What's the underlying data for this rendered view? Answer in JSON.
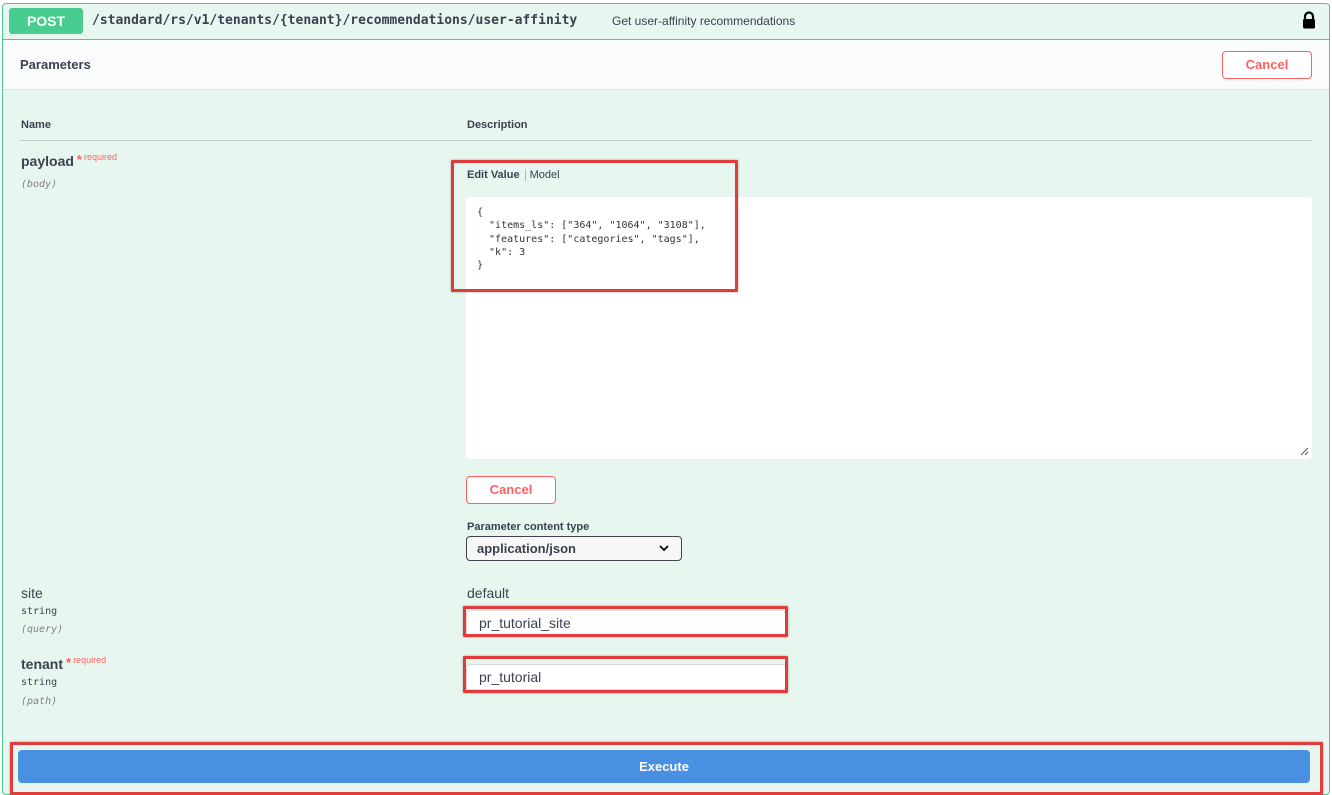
{
  "operation": {
    "method": "POST",
    "path": "/standard/rs/v1/tenants/{tenant}/recommendations/user-affinity",
    "summary": "Get user-affinity recommendations",
    "lock_icon": "lock-icon"
  },
  "parameters_section": {
    "title": "Parameters",
    "cancel_label": "Cancel",
    "col_name": "Name",
    "col_description": "Description"
  },
  "payload": {
    "name": "payload",
    "required_star": "*",
    "required_text": "required",
    "in": "(body)",
    "tab_edit": "Edit Value",
    "tab_model": "Model",
    "body_value": "{\n  \"items_ls\": [\"364\", \"1064\", \"3108\"],\n  \"features\": [\"categories\", \"tags\"],\n  \"k\": 3\n}",
    "cancel_label": "Cancel",
    "content_type_label": "Parameter content type",
    "content_type_value": "application/json"
  },
  "site": {
    "name": "site",
    "type": "string",
    "in": "(query)",
    "default_label": "default",
    "value": "pr_tutorial_site"
  },
  "tenant": {
    "name": "tenant",
    "required_star": "*",
    "required_text": "required",
    "type": "string",
    "in": "(path)",
    "value": "pr_tutorial"
  },
  "execute_label": "Execute",
  "colors": {
    "post_green": "#49cc90",
    "panel_bg": "#e8f6f0",
    "cancel_red": "#ff6060",
    "execute_blue": "#4990e2",
    "highlight_red": "#e03c3c"
  }
}
